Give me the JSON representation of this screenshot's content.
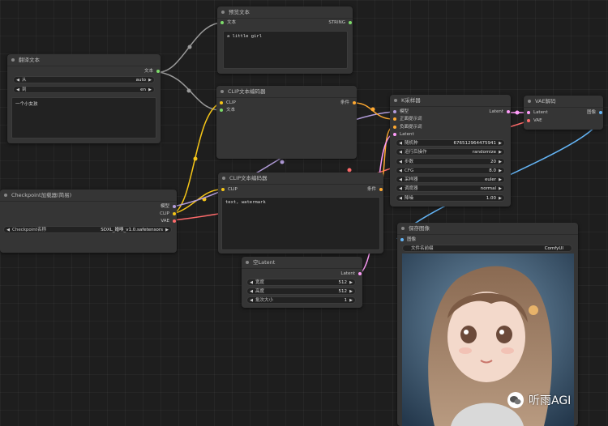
{
  "colors": {
    "model": "#b39ddb",
    "clip": "#f5c518",
    "vae": "#ff6b6b",
    "conditioning": "#ffa931",
    "latent": "#ff9cf9",
    "image": "#64b5f6",
    "string": "#7ddc6a",
    "wire_gray": "#9a9a9a"
  },
  "nodes": {
    "translate": {
      "title": "翻译文本",
      "out_text": "文本",
      "from_label": "从",
      "from_value": "auto",
      "to_label": "到",
      "to_value": "en",
      "text": "一个小女孩"
    },
    "preview": {
      "title": "预览文本",
      "in_text": "文本",
      "out_string": "STRING",
      "text": "a little girl"
    },
    "clip_pos": {
      "title": "CLIP文本编码器",
      "in_clip": "CLIP",
      "in_text": "文本",
      "out_cond": "条件"
    },
    "clip_neg": {
      "title": "CLIP文本编码器",
      "in_clip": "CLIP",
      "out_cond": "条件",
      "text": "text, watermark"
    },
    "checkpoint": {
      "title": "Checkpoint加载器(简易)",
      "out_model": "模型",
      "out_clip": "CLIP",
      "out_vae": "VAE",
      "ckpt_label": "Checkpoint名称",
      "ckpt_value": "SDXL_婚嗅_v1.0.safetensors"
    },
    "ksampler": {
      "title": "K采样器",
      "in_model": "模型",
      "in_pos": "正面提示词",
      "in_neg": "负面提示词",
      "in_latent": "Latent",
      "out_latent": "Latent",
      "seed_label": "随机种",
      "seed_value": "676512964475941",
      "control_label": "运行后操作",
      "control_value": "randomize",
      "steps_label": "步数",
      "steps_value": "20",
      "cfg_label": "CFG",
      "cfg_value": "8.0",
      "sampler_label": "采样器",
      "sampler_value": "euler",
      "scheduler_label": "调度器",
      "scheduler_value": "normal",
      "denoise_label": "降噪",
      "denoise_value": "1.00"
    },
    "vae_decode": {
      "title": "VAE解码",
      "in_latent": "Latent",
      "in_vae": "VAE",
      "out_image": "图像"
    },
    "empty_latent": {
      "title": "空Latent",
      "out_latent": "Latent",
      "width_label": "宽度",
      "width_value": "512",
      "height_label": "高度",
      "height_value": "512",
      "batch_label": "批次大小",
      "batch_value": "1"
    },
    "save_image": {
      "title": "保存图像",
      "in_image": "图像",
      "prefix_label": "文件名前缀",
      "prefix_value": "ComfyUI"
    }
  },
  "watermark": {
    "text": "听雨AGI"
  }
}
